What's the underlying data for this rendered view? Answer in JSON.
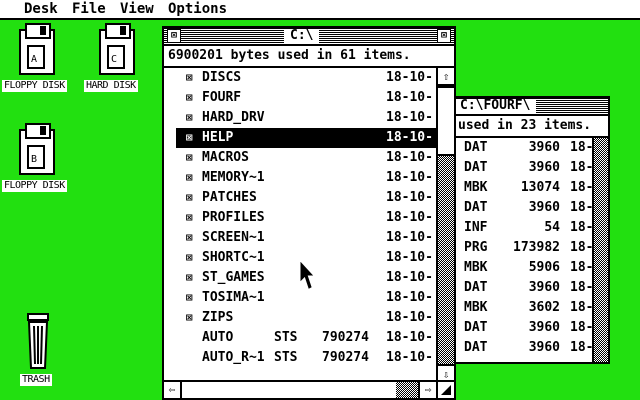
{
  "menubar": {
    "items": [
      "Desk",
      "File",
      "View",
      "Options"
    ]
  },
  "desktop": {
    "background": "#22e010",
    "icons": [
      {
        "label": "FLOPPY DISK",
        "kind": "floppy-icon"
      },
      {
        "label": "HARD DISK",
        "kind": "hard-disk-icon"
      },
      {
        "label": "FLOPPY DISK",
        "kind": "floppy-icon"
      },
      {
        "label": "TRASH",
        "kind": "trash-icon"
      }
    ]
  },
  "window_c": {
    "title": "C:\\",
    "info": "6900201 bytes used in 61 items.",
    "close_glyph": "⊠",
    "full_glyph": "⊠",
    "scroll_up": "⇧",
    "scroll_down": "⇩",
    "scroll_left": "⇦",
    "scroll_right": "⇨",
    "folder_glyph": "⊠",
    "rows": [
      {
        "name": "DISCS",
        "type": "",
        "size": "",
        "date": "18-10-",
        "folder": true,
        "selected": false
      },
      {
        "name": "FOURF",
        "type": "",
        "size": "",
        "date": "18-10-",
        "folder": true,
        "selected": false
      },
      {
        "name": "HARD_DRV",
        "type": "",
        "size": "",
        "date": "18-10-",
        "folder": true,
        "selected": false
      },
      {
        "name": "HELP",
        "type": "",
        "size": "",
        "date": "18-10-",
        "folder": true,
        "selected": true
      },
      {
        "name": "MACROS",
        "type": "",
        "size": "",
        "date": "18-10-",
        "folder": true,
        "selected": false
      },
      {
        "name": "MEMORY~1",
        "type": "",
        "size": "",
        "date": "18-10-",
        "folder": true,
        "selected": false
      },
      {
        "name": "PATCHES",
        "type": "",
        "size": "",
        "date": "18-10-",
        "folder": true,
        "selected": false
      },
      {
        "name": "PROFILES",
        "type": "",
        "size": "",
        "date": "18-10-",
        "folder": true,
        "selected": false
      },
      {
        "name": "SCREEN~1",
        "type": "",
        "size": "",
        "date": "18-10-",
        "folder": true,
        "selected": false
      },
      {
        "name": "SHORTC~1",
        "type": "",
        "size": "",
        "date": "18-10-",
        "folder": true,
        "selected": false
      },
      {
        "name": "ST_GAMES",
        "type": "",
        "size": "",
        "date": "18-10-",
        "folder": true,
        "selected": false
      },
      {
        "name": "TOSIMA~1",
        "type": "",
        "size": "",
        "date": "18-10-",
        "folder": true,
        "selected": false
      },
      {
        "name": "ZIPS",
        "type": "",
        "size": "",
        "date": "18-10-",
        "folder": true,
        "selected": false
      },
      {
        "name": "AUTO",
        "type": "STS",
        "size": "790274",
        "date": "18-10-",
        "folder": false,
        "selected": false
      },
      {
        "name": "AUTO_R~1",
        "type": "STS",
        "size": "790274",
        "date": "18-10-",
        "folder": false,
        "selected": false
      }
    ]
  },
  "window_fourf": {
    "title": "C:\\FOURF\\",
    "info": "used in 23 items.",
    "rows": [
      {
        "type": "DAT",
        "size": "3960",
        "date": "18-"
      },
      {
        "type": "DAT",
        "size": "3960",
        "date": "18-"
      },
      {
        "type": "MBK",
        "size": "13074",
        "date": "18-"
      },
      {
        "type": "DAT",
        "size": "3960",
        "date": "18-"
      },
      {
        "type": "INF",
        "size": "54",
        "date": "18-"
      },
      {
        "type": "PRG",
        "size": "173982",
        "date": "18-"
      },
      {
        "type": "MBK",
        "size": "5906",
        "date": "18-"
      },
      {
        "type": "DAT",
        "size": "3960",
        "date": "18-"
      },
      {
        "type": "MBK",
        "size": "3602",
        "date": "18-"
      },
      {
        "type": "DAT",
        "size": "3960",
        "date": "18-"
      },
      {
        "type": "DAT",
        "size": "3960",
        "date": "18-"
      }
    ]
  }
}
